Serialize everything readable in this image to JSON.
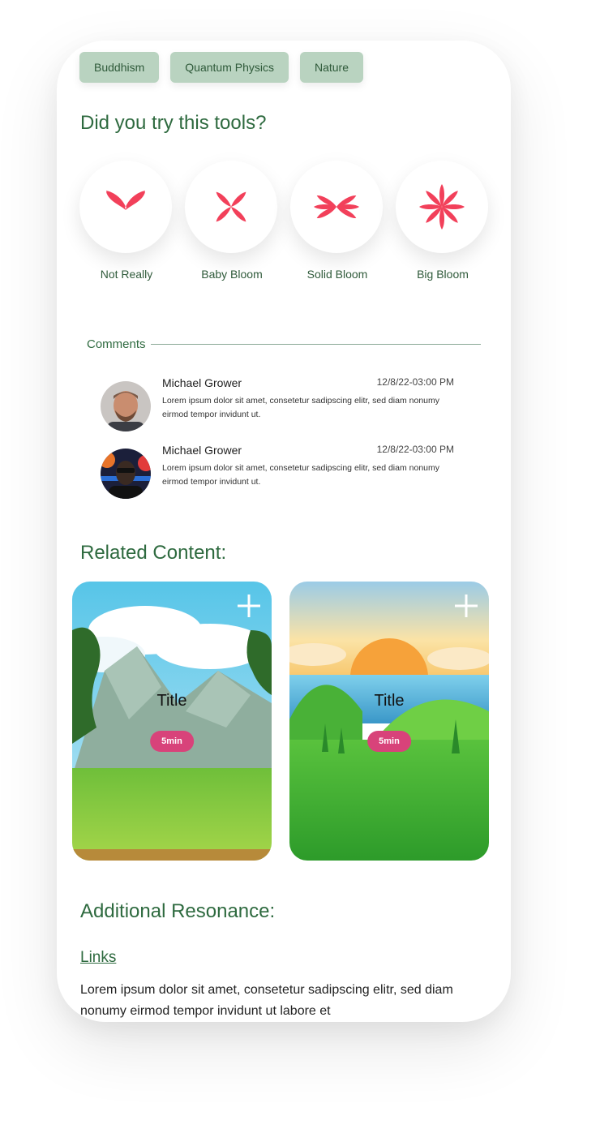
{
  "tags": [
    "Buddhism",
    "Quantum Physics",
    "Nature"
  ],
  "tools_heading": "Did you try this tools?",
  "tools": [
    {
      "label": "Not Really",
      "icon": "two-petal-icon"
    },
    {
      "label": "Baby Bloom",
      "icon": "four-petal-icon"
    },
    {
      "label": "Solid Bloom",
      "icon": "six-petal-icon"
    },
    {
      "label": "Big Bloom",
      "icon": "eight-petal-icon"
    }
  ],
  "comments_label": "Comments",
  "comments": [
    {
      "name": "Michael Grower",
      "date": "12/8/22-03:00 PM",
      "text": "Lorem ipsum dolor sit amet, consetetur sadipscing elitr, sed diam nonumy eirmod tempor invidunt ut."
    },
    {
      "name": "Michael Grower",
      "date": "12/8/22-03:00 PM",
      "text": "Lorem ipsum dolor sit amet, consetetur sadipscing elitr, sed diam nonumy eirmod tempor invidunt ut."
    }
  ],
  "related_heading": "Related Content:",
  "cards": [
    {
      "title": "Title",
      "duration": "5min"
    },
    {
      "title": "Title",
      "duration": "5min"
    }
  ],
  "additional_heading": "Additional Resonance:",
  "links_label": "Links",
  "paragraph": "Lorem ipsum dolor sit amet, consetetur sadipscing elitr, sed diam nonumy eirmod tempor invidunt ut labore et",
  "colors": {
    "accent_green": "#2e6a3f",
    "tag_bg": "#b9d3c0",
    "petal": "#f2405a",
    "pill": "#d8437a"
  }
}
